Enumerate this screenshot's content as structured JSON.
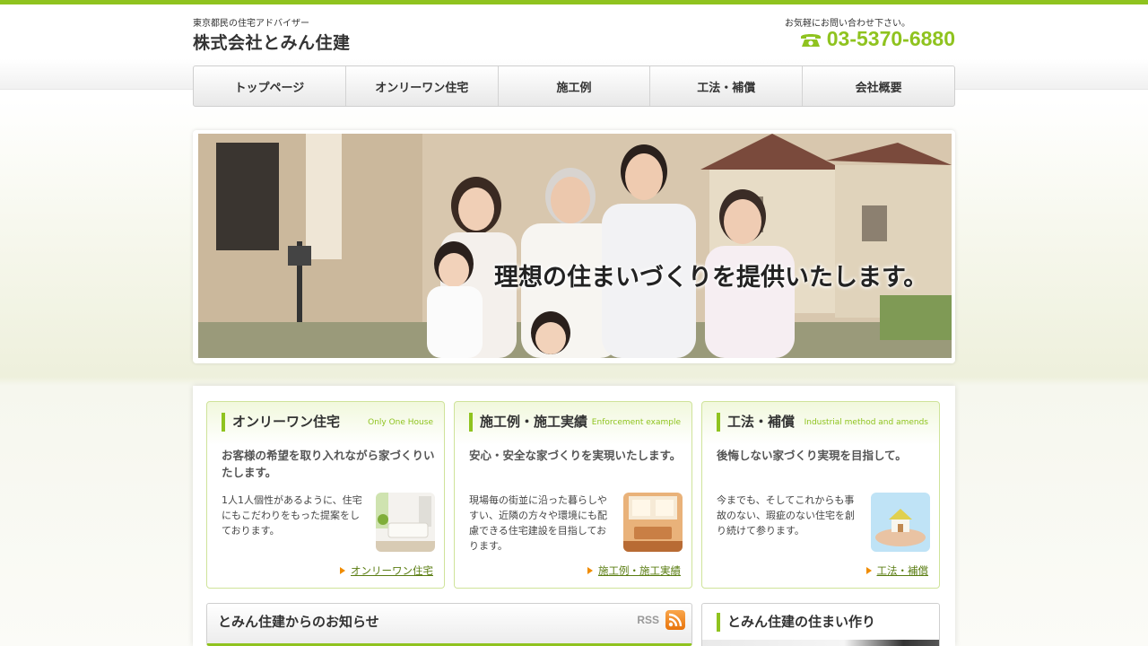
{
  "header": {
    "tagline": "東京都民の住宅アドバイザー",
    "company": "株式会社とみん住建",
    "contact_note": "お気軽にお問い合わせ下さい。",
    "phone": "03-5370-6880",
    "phone_icon": "telephone-icon"
  },
  "nav": {
    "items": [
      {
        "label": "トップページ"
      },
      {
        "label": "オンリーワン住宅"
      },
      {
        "label": "施工例"
      },
      {
        "label": "工法・補償"
      },
      {
        "label": "会社概要"
      }
    ]
  },
  "hero": {
    "caption": "理想の住まいづくりを提供いたします。"
  },
  "cards": [
    {
      "title": "オンリーワン住宅",
      "subtitle": "Only One House",
      "lead": "お客様の希望を取り入れながら家づくりいたします。",
      "body": "1人1人個性があるように、住宅にもこだわりをもった提案をしております。",
      "link": "オンリーワン住宅"
    },
    {
      "title": "施工例・施工実績",
      "subtitle": "Enforcement example",
      "lead": "安心・安全な家づくりを実現いたします。",
      "body": "現場毎の街並に沿った暮らしやすい、近隣の方々や環境にも配慮できる住宅建設を目指しております。",
      "link": "施工例・施工実績"
    },
    {
      "title": "工法・補償",
      "subtitle": "Industrial method and amends",
      "lead": "後悔しない家づくり実現を目指して。",
      "body": "今までも、そしてこれからも事故のない、瑕疵のない住宅を創り続けて参ります。",
      "link": "工法・補償"
    }
  ],
  "news": {
    "title": "とみん住建からのお知らせ",
    "rss_label": "RSS"
  },
  "side": {
    "title": "とみん住建の住まい作り"
  },
  "colors": {
    "accent": "#8fc31f",
    "link": "#5a7d12",
    "arrow": "#f08c00"
  }
}
